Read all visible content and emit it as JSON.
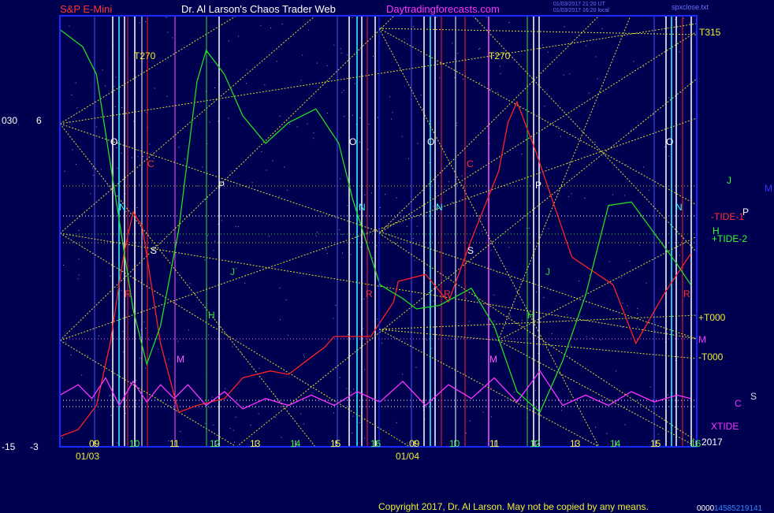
{
  "header": {
    "left_title": "S&P E-Mini",
    "center_title": "Dr. Al Larson's Chaos Trader Web",
    "site": "Daytradingforecasts.com",
    "timestamp_line1": "01/03/2017 21:20 UT",
    "timestamp_line2": "01/03/2017 16:20 local",
    "file": "spxclose.txt"
  },
  "footer": {
    "copyright": "Copyright 2017, Dr. Al Larson. May not be copied by any means.",
    "code": "0000",
    "number": "14585219141"
  },
  "left_axis": {
    "top_a": "030",
    "top_b": "6",
    "bottom_a": "-15",
    "bottom_b": "-3"
  },
  "right_labels": {
    "t315": "T315",
    "tide_minus_1": "-TIDE-1",
    "tide_plus_2": "+TIDE-2",
    "t000_plus": "+T000",
    "t000_minus": "-T000",
    "xtide": "XTIDE",
    "year": "2017",
    "J": "J",
    "M": "M",
    "P": "P",
    "H": "H",
    "C": "C",
    "S": "S"
  },
  "colors": {
    "background": "#000050",
    "frame": "#1a2bff",
    "red_curve": "#ff2222",
    "green_curve": "#22dd22",
    "magenta_curve": "#ff33ff",
    "yellow_lines": "#dddd33",
    "white_lines": "#ffffff",
    "cyan_lines": "#33ffff"
  },
  "chart_data": {
    "type": "line",
    "x_days": [
      "01/03",
      "01/04"
    ],
    "x_ticks_day1": [
      "09",
      "10",
      "11",
      "12",
      "13",
      "14",
      "15",
      "16"
    ],
    "x_ticks_day2": [
      "09",
      "10",
      "11",
      "12",
      "13",
      "14",
      "15",
      "16"
    ],
    "grid": "dotted",
    "series": [
      {
        "name": "TIDE-1",
        "color": "red",
        "points": [
          [
            0,
            -2.7
          ],
          [
            0.4,
            -2.5
          ],
          [
            0.8,
            -1.8
          ],
          [
            1.1,
            0
          ],
          [
            1.4,
            2.6
          ],
          [
            1.6,
            3.8
          ],
          [
            1.8,
            3.4
          ],
          [
            2.2,
            0
          ],
          [
            2.6,
            -2.0
          ],
          [
            3.0,
            -1.8
          ],
          [
            3.6,
            -1.6
          ],
          [
            4.0,
            -1.0
          ],
          [
            4.6,
            -0.8
          ],
          [
            5.0,
            -0.9
          ],
          [
            5.5,
            -0.4
          ],
          [
            5.8,
            -0.1
          ],
          [
            6.0,
            0.2
          ],
          [
            6.8,
            0.2
          ],
          [
            7.3,
            1.2
          ],
          [
            7.4,
            1.8
          ],
          [
            8.0,
            2.0
          ],
          [
            8.5,
            1.2
          ],
          [
            9.0,
            3.0
          ],
          [
            9.6,
            5.0
          ],
          [
            9.8,
            6.4
          ],
          [
            10.0,
            7.0
          ],
          [
            10.4,
            5.6
          ],
          [
            11.2,
            2.5
          ],
          [
            12.1,
            1.7
          ],
          [
            12.6,
            0
          ],
          [
            13.2,
            1.4
          ],
          [
            13.8,
            2.6
          ]
        ]
      },
      {
        "name": "TIDE-2",
        "color": "green",
        "points": [
          [
            0,
            9.1
          ],
          [
            0.5,
            8.6
          ],
          [
            0.8,
            7.8
          ],
          [
            1.2,
            4.4
          ],
          [
            1.6,
            1.0
          ],
          [
            1.9,
            -0.6
          ],
          [
            2.2,
            0.5
          ],
          [
            2.6,
            3.3
          ],
          [
            3.0,
            7.6
          ],
          [
            3.2,
            8.5
          ],
          [
            3.6,
            7.8
          ],
          [
            4.0,
            6.6
          ],
          [
            4.5,
            5.8
          ],
          [
            5.0,
            6.4
          ],
          [
            5.6,
            6.8
          ],
          [
            6.1,
            5.8
          ],
          [
            6.4,
            4.2
          ],
          [
            7.0,
            1.7
          ],
          [
            7.5,
            1.3
          ],
          [
            7.8,
            1.0
          ],
          [
            8.3,
            1.1
          ],
          [
            9.0,
            1.6
          ],
          [
            9.5,
            0.5
          ],
          [
            10.0,
            -1.4
          ],
          [
            10.5,
            -2.0
          ],
          [
            11.0,
            -0.5
          ],
          [
            11.5,
            1.4
          ],
          [
            12.0,
            4.0
          ],
          [
            12.5,
            4.1
          ],
          [
            13.0,
            3.2
          ],
          [
            13.5,
            2.3
          ],
          [
            13.8,
            1.7
          ]
        ]
      },
      {
        "name": "XTIDE",
        "color": "magenta",
        "points": [
          [
            0,
            -1.5
          ],
          [
            0.4,
            -1.2
          ],
          [
            0.7,
            -1.6
          ],
          [
            1.0,
            -1.0
          ],
          [
            1.3,
            -1.8
          ],
          [
            1.6,
            -1.1
          ],
          [
            1.9,
            -1.7
          ],
          [
            2.2,
            -1.2
          ],
          [
            2.5,
            -1.6
          ],
          [
            2.8,
            -1.2
          ],
          [
            3.2,
            -1.8
          ],
          [
            3.6,
            -1.4
          ],
          [
            4.0,
            -1.9
          ],
          [
            4.5,
            -1.6
          ],
          [
            5.0,
            -1.8
          ],
          [
            5.5,
            -1.5
          ],
          [
            6.0,
            -1.8
          ],
          [
            6.5,
            -1.4
          ],
          [
            7.0,
            -1.7
          ],
          [
            7.5,
            -1.1
          ],
          [
            8.0,
            -1.8
          ],
          [
            8.5,
            -1.2
          ],
          [
            9.0,
            -1.6
          ],
          [
            9.5,
            -1.0
          ],
          [
            10.0,
            -1.7
          ],
          [
            10.5,
            -0.8
          ],
          [
            11.0,
            -1.8
          ],
          [
            11.5,
            -1.5
          ],
          [
            12.0,
            -1.8
          ],
          [
            12.5,
            -1.4
          ],
          [
            13.0,
            -1.7
          ],
          [
            13.5,
            -1.5
          ],
          [
            13.8,
            -1.6
          ]
        ]
      }
    ]
  }
}
